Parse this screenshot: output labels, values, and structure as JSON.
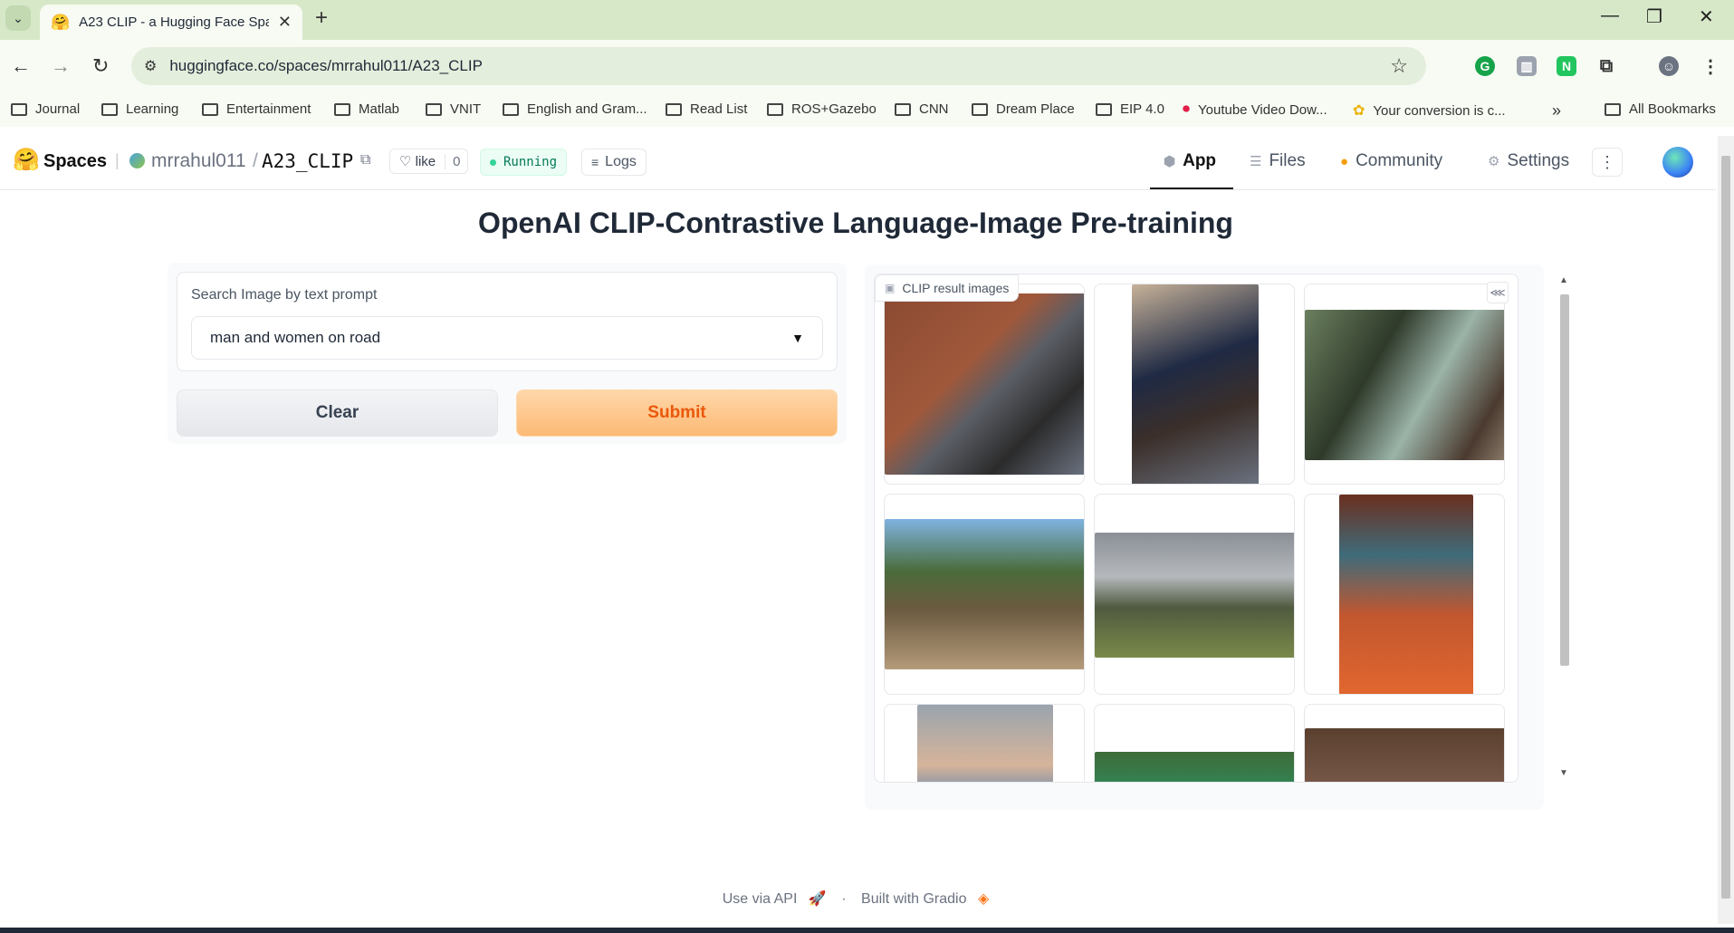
{
  "browser": {
    "tab_title": "A23 CLIP - a Hugging Face Space",
    "url": "huggingface.co/spaces/mrrahul011/A23_CLIP",
    "bookmarks": [
      "Journal",
      "Learning",
      "Entertainment",
      "Matlab",
      "VNIT",
      "English and Gram...",
      "Read List",
      "ROS+Gazebo",
      "CNN",
      "Dream Place",
      "EIP 4.0",
      "Youtube Video Dow...",
      "Your conversion is c...",
      "All Bookmarks"
    ]
  },
  "hf": {
    "spaces_label": "Spaces",
    "owner": "mrrahul011",
    "repo": "A23_CLIP",
    "like_label": "like",
    "like_count": "0",
    "status": "Running",
    "logs_label": "Logs",
    "nav": [
      "App",
      "Files",
      "Community",
      "Settings"
    ]
  },
  "app": {
    "title": "OpenAI CLIP-Contrastive Language-Image Pre-training",
    "input_label": "Search Image by text prompt",
    "input_value": "man and women on road",
    "clear_label": "Clear",
    "submit_label": "Submit",
    "gallery_label": "CLIP result images"
  },
  "footer": {
    "api": "Use via API",
    "sep": "·",
    "built": "Built with Gradio"
  },
  "colors": {
    "submit_text": "#ea580c",
    "running_text": "#047857",
    "tabbar": "#d7e8c9"
  }
}
